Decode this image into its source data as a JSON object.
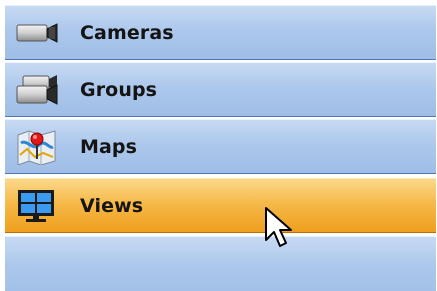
{
  "navigation": {
    "items": [
      {
        "label": "Cameras",
        "icon": "camera-icon"
      },
      {
        "label": "Groups",
        "icon": "camera-group-icon"
      },
      {
        "label": "Maps",
        "icon": "map-pin-icon"
      },
      {
        "label": "Views",
        "icon": "monitor-grid-icon",
        "active": true
      }
    ]
  },
  "colors": {
    "item_background": "#adc8ec",
    "active_background": "#f6b94a",
    "border": "#4f78b6",
    "label_text": "#141414"
  }
}
